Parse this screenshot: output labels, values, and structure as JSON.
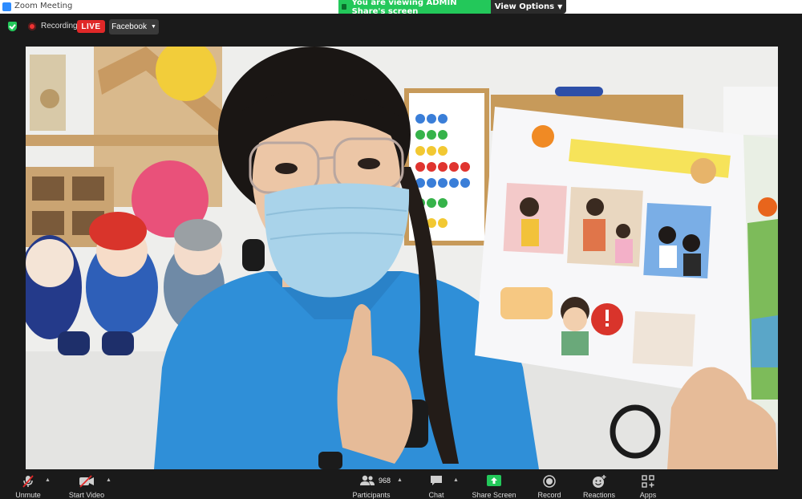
{
  "window": {
    "title": "Zoom Meeting"
  },
  "share_bar": {
    "status": "You are viewing ADMIN Share's screen",
    "view_options": "View Options"
  },
  "status_row": {
    "recording": "Recording",
    "live": "LIVE",
    "platform": "Facebook"
  },
  "toolbar": {
    "unmute": "Unmute",
    "start_video": "Start Video",
    "participants": "Participants",
    "participant_count": "968",
    "chat": "Chat",
    "share_screen": "Share Screen",
    "record": "Record",
    "reactions": "Reactions",
    "apps": "Apps"
  },
  "colors": {
    "share_green": "#23c85a",
    "live_red": "#e02828",
    "toolbar_bg": "#1a1a1a",
    "shirt_blue": "#2f8fd8"
  }
}
